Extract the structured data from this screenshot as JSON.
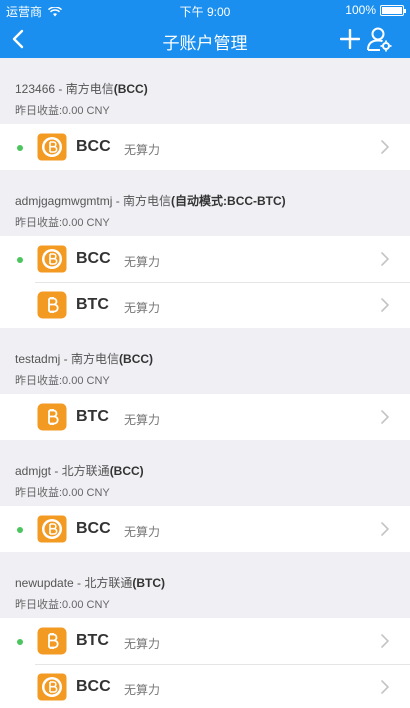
{
  "status_bar": {
    "carrier": "运营商",
    "time": "下午 9:00",
    "battery": "100%"
  },
  "nav": {
    "title": "子账户管理"
  },
  "colors": {
    "accent": "#1a8ff0",
    "coin_orange": "#f39a23",
    "active_dot": "#4cc55f"
  },
  "accounts": [
    {
      "title_name": "123466 - 南方电信",
      "title_bold": "(BCC)",
      "earnings": "昨日收益:0.00 CNY",
      "coins": [
        {
          "symbol": "BCC",
          "status": "无算力",
          "active": true,
          "icon": "bcc-coin-icon"
        }
      ]
    },
    {
      "title_name": "admjgagmwgmtmj - 南方电信",
      "title_bold": "(自动模式:BCC-BTC)",
      "earnings": "昨日收益:0.00 CNY",
      "coins": [
        {
          "symbol": "BCC",
          "status": "无算力",
          "active": true,
          "icon": "bcc-coin-icon"
        },
        {
          "symbol": "BTC",
          "status": "无算力",
          "active": false,
          "icon": "btc-coin-icon"
        }
      ]
    },
    {
      "title_name": "testadmj - 南方电信",
      "title_bold": "(BCC)",
      "earnings": "昨日收益:0.00 CNY",
      "coins": [
        {
          "symbol": "BTC",
          "status": "无算力",
          "active": false,
          "icon": "btc-coin-icon"
        }
      ]
    },
    {
      "title_name": "admjgt - 北方联通",
      "title_bold": "(BCC)",
      "earnings": "昨日收益:0.00 CNY",
      "coins": [
        {
          "symbol": "BCC",
          "status": "无算力",
          "active": true,
          "icon": "bcc-coin-icon"
        }
      ]
    },
    {
      "title_name": "newupdate - 北方联通",
      "title_bold": "(BTC)",
      "earnings": "昨日收益:0.00 CNY",
      "coins": [
        {
          "symbol": "BTC",
          "status": "无算力",
          "active": true,
          "icon": "btc-coin-icon"
        },
        {
          "symbol": "BCC",
          "status": "无算力",
          "active": false,
          "icon": "bcc-coin-icon"
        }
      ]
    }
  ]
}
